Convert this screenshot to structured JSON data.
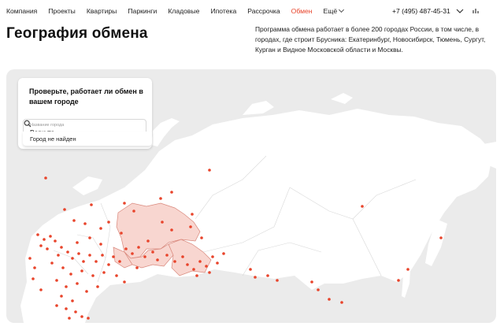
{
  "nav": {
    "items": [
      "Компания",
      "Проекты",
      "Квартиры",
      "Паркинги",
      "Кладовые",
      "Ипотека",
      "Рассрочка",
      "Обмен"
    ],
    "active": "Обмен",
    "more_label": "Ещё",
    "phone": "+7 (495) 487-45-31"
  },
  "page": {
    "title": "География обмена",
    "description": "Программа обмена работает в более 200 городах России, в том числе, в городах, где строит Брусника: Екатеринбург, Новосибирск, Тюмень, Сургут, Курган и Видное Московской области и Москвы."
  },
  "search": {
    "heading": "Проверьте, работает ли обмен в вашем городе",
    "field_label": "Название города",
    "value": "Воркута",
    "no_result": "Город не найден"
  },
  "colors": {
    "accent": "#e8442b",
    "map_land": "#ffffff",
    "map_background": "#ebebeb",
    "highlight_region": "#f8d6d0",
    "city_dot": "#e8442b"
  },
  "icons": [
    "search-icon",
    "chevron-down-icon",
    "bar-chart-icon"
  ]
}
